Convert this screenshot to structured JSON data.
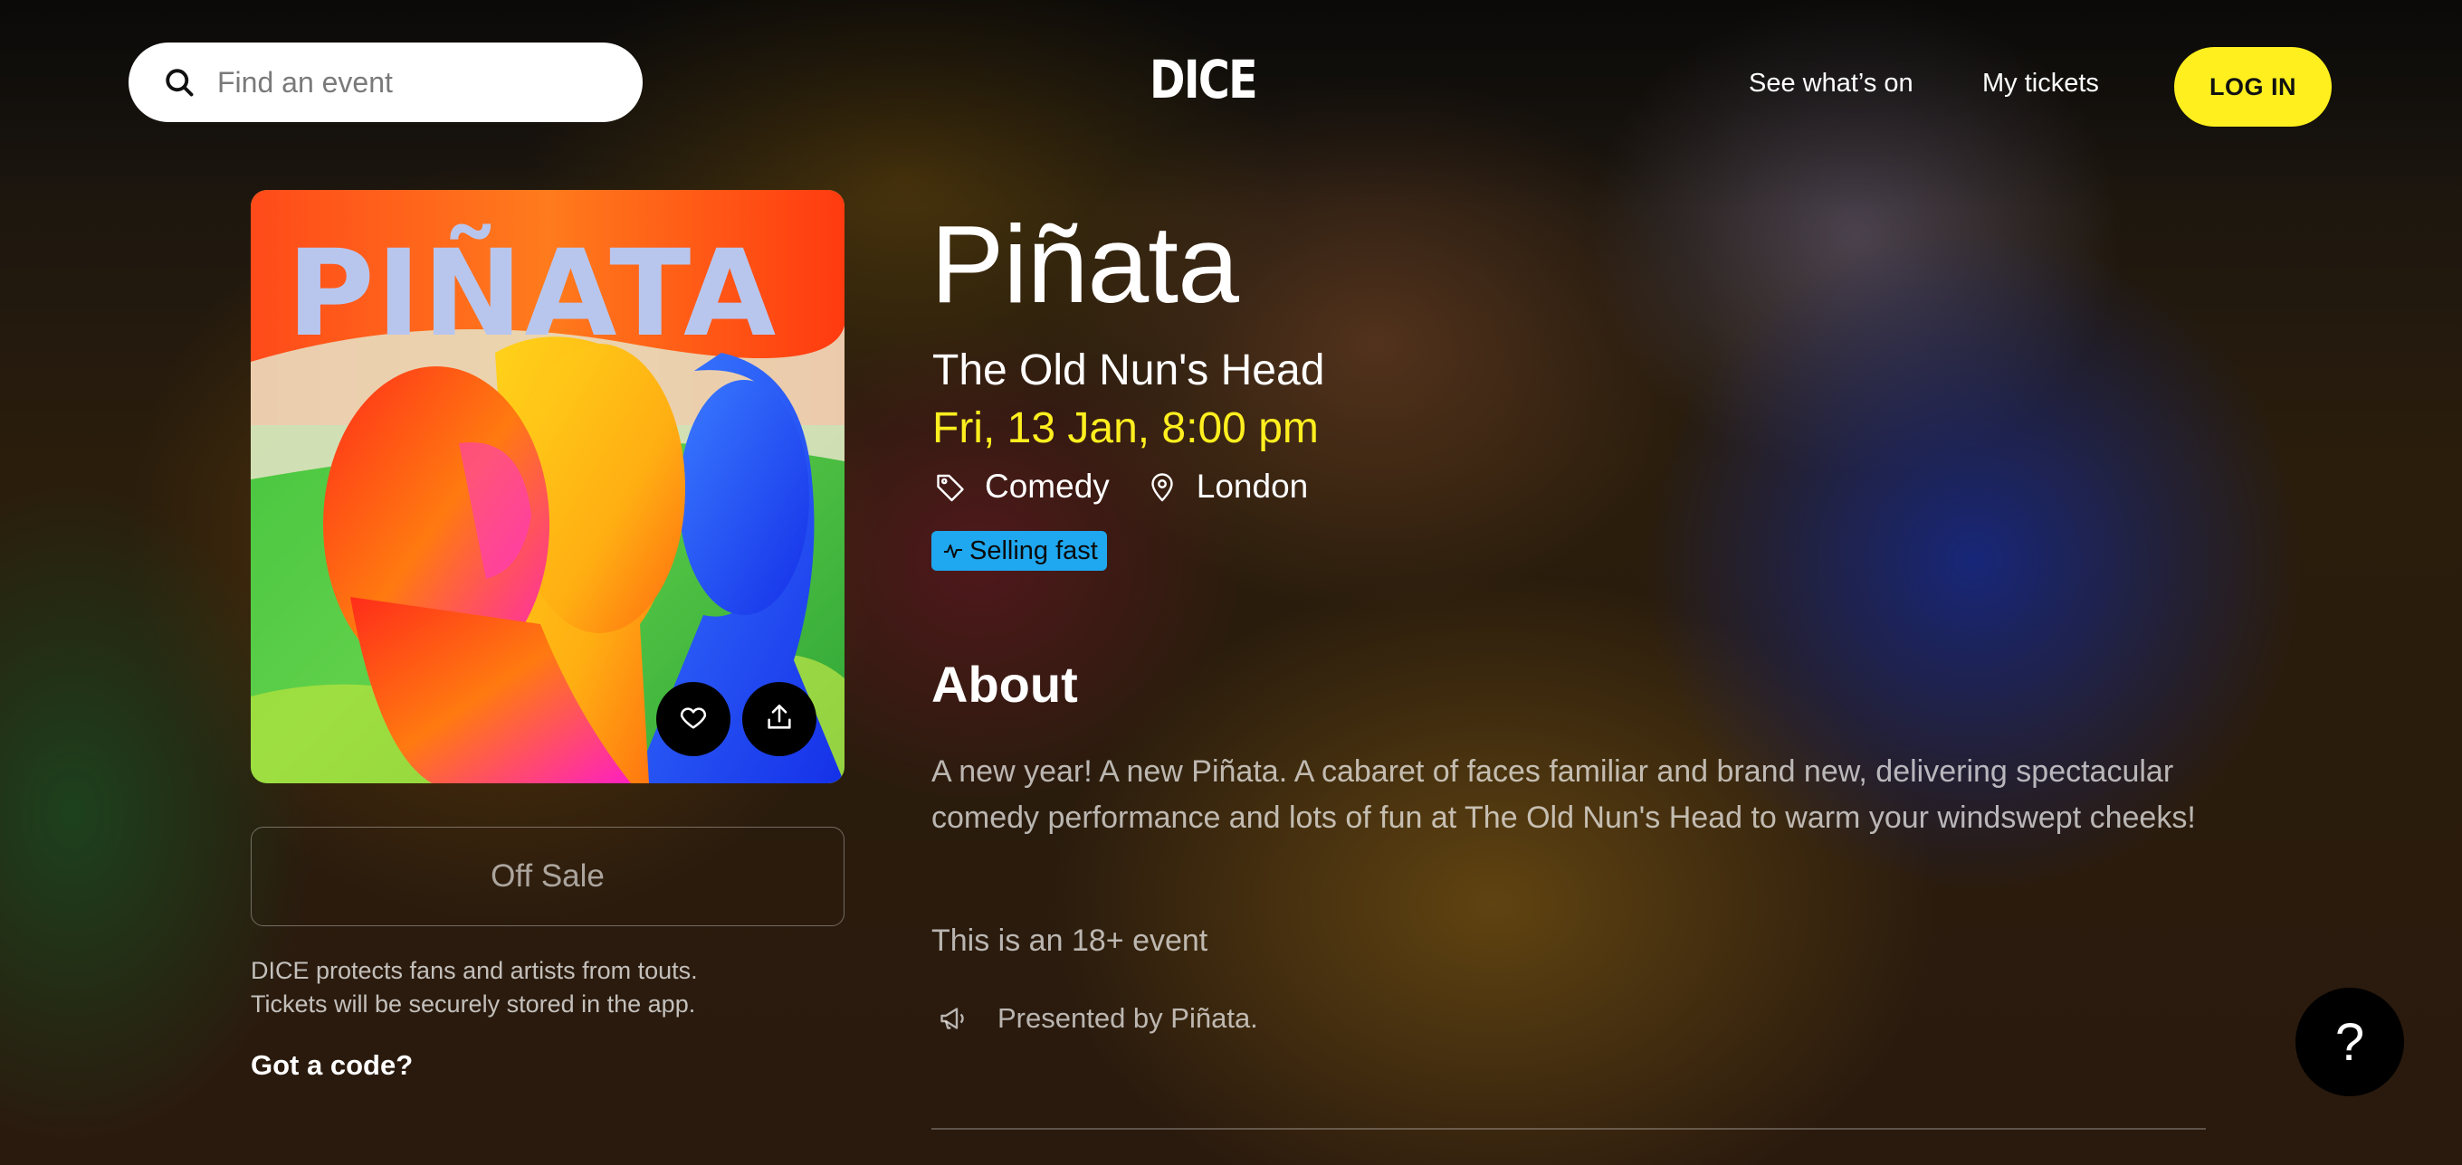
{
  "header": {
    "search_placeholder": "Find an event",
    "logo": "DICE",
    "nav": {
      "whats_on": "See what’s on",
      "my_tickets": "My tickets"
    },
    "login": "LOG IN"
  },
  "event": {
    "poster_text": "PIÑATA",
    "title": "Piñata",
    "venue": "The Old Nun's Head",
    "date": "Fri, 13 Jan, 8:00 pm",
    "genre": "Comedy",
    "city": "London",
    "badge": "Selling fast"
  },
  "purchase": {
    "status": "Off Sale",
    "protect_line1": "DICE protects fans and artists from touts.",
    "protect_line2": "Tickets will be securely stored in the app.",
    "code_link": "Got a code?"
  },
  "about": {
    "heading": "About",
    "description": "A new year! A new Piñata. A cabaret of faces familiar and brand new, delivering spectacular comedy performance and lots of fun at The Old Nun's Head to warm your windswept cheeks!",
    "age": "This is an 18+ event",
    "presented_by": "Presented by Piñata."
  },
  "help": {
    "label": "?"
  },
  "colors": {
    "accent_yellow": "#ffef1f",
    "badge_blue": "#1fa8ef",
    "login_bg": "#ffef1f"
  },
  "icons": [
    "search-icon",
    "heart-icon",
    "share-icon",
    "tag-icon",
    "location-pin-icon",
    "pulse-icon",
    "megaphone-icon"
  ]
}
